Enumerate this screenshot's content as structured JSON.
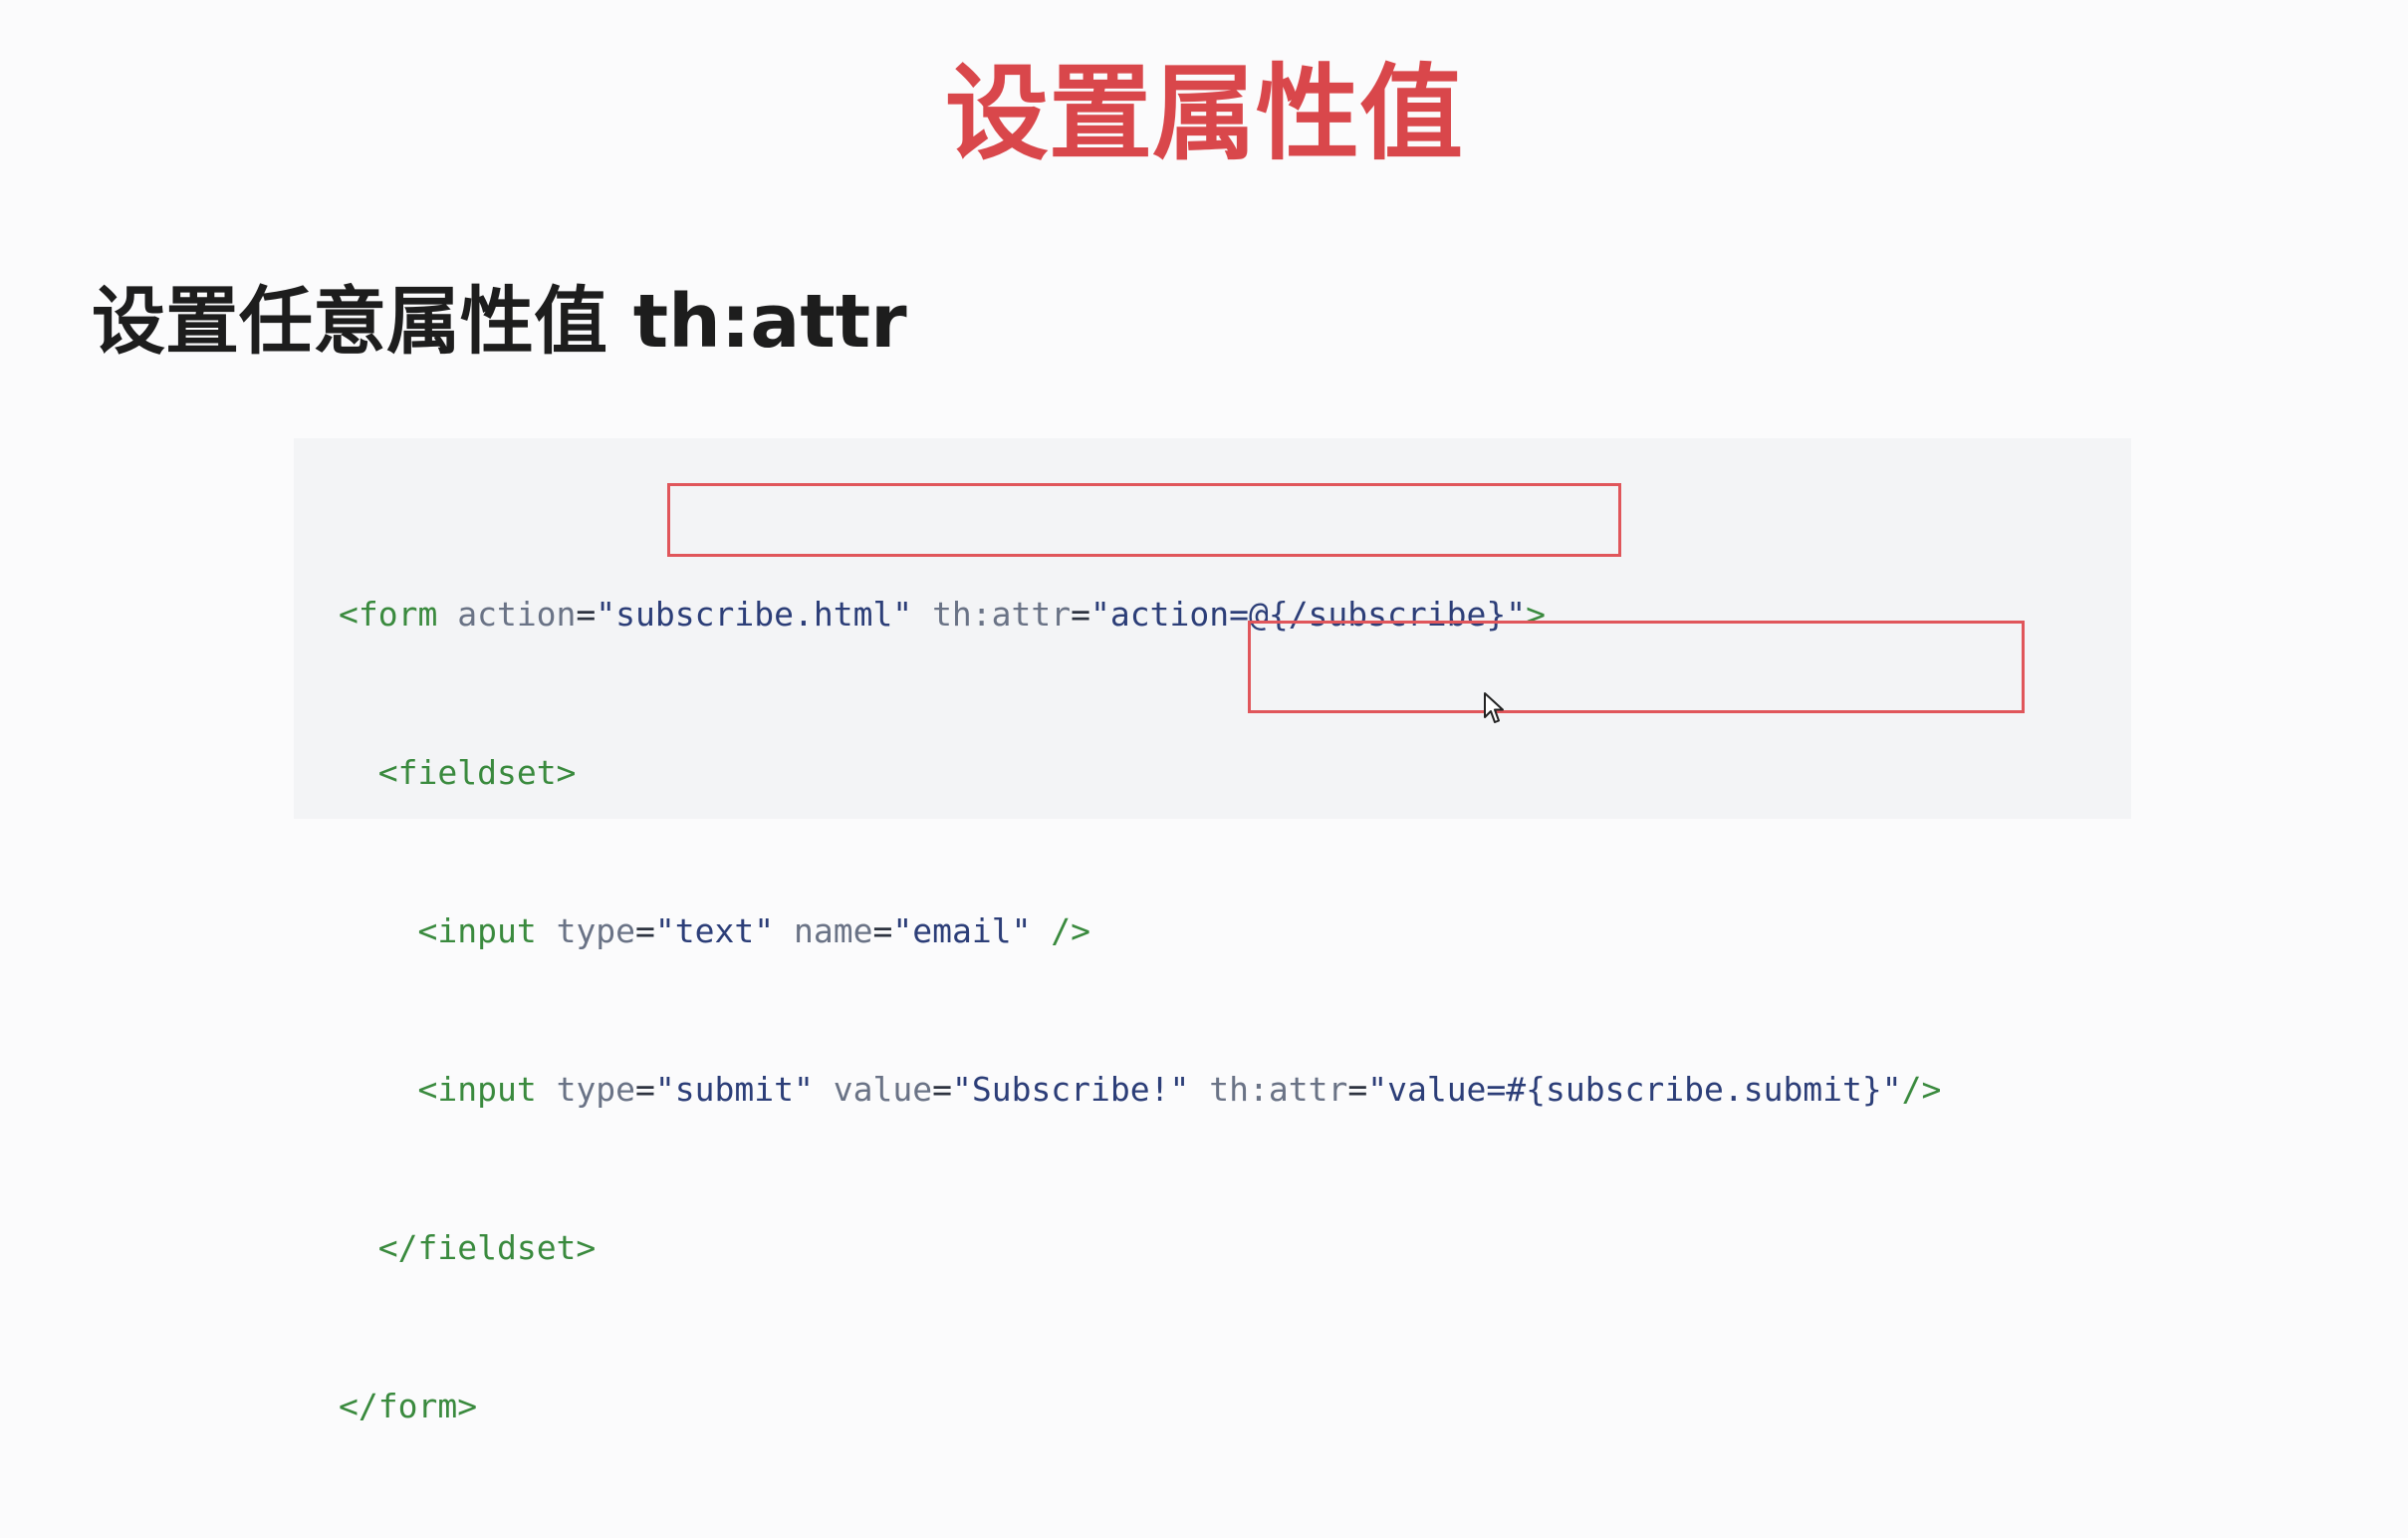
{
  "slide": {
    "title": "设置属性值",
    "heading": "设置任意属性值 th:attr"
  },
  "code": {
    "line1": {
      "open": "<form",
      "attr1_name": " action",
      "eq1": "=",
      "attr1_value": "\"subscribe.html\"",
      "space": " ",
      "attr2_name": "th:attr",
      "eq2": "=",
      "attr2_value": "\"action=@{/subscribe}\"",
      "close": ">"
    },
    "line2": {
      "indent": "  ",
      "tag": "<fieldset>"
    },
    "line3": {
      "indent": "    ",
      "open": "<input",
      "attr1_name": " type",
      "eq1": "=",
      "attr1_value": "\"text\"",
      "attr2_name": " name",
      "eq2": "=",
      "attr2_value": "\"email\"",
      "close": " />"
    },
    "line4": {
      "indent": "    ",
      "open": "<input",
      "attr1_name": " type",
      "eq1": "=",
      "attr1_value": "\"submit\"",
      "attr2_name": " value",
      "eq2": "=",
      "attr2_value": "\"Subscribe!\"",
      "attr3_name": " th:attr",
      "eq3": "=",
      "attr3_value": "\"value=#{subscribe.submit}\"",
      "close": "/>"
    },
    "line5": {
      "indent": "  ",
      "tag": "</fieldset>"
    },
    "line6": {
      "tag": "</form>"
    }
  },
  "colors": {
    "title": "#d9474b",
    "highlight": "#e0565b",
    "tag": "#3a8a3e",
    "string": "#2c3e78"
  },
  "icons": {
    "cursor": "mouse-pointer-icon"
  }
}
